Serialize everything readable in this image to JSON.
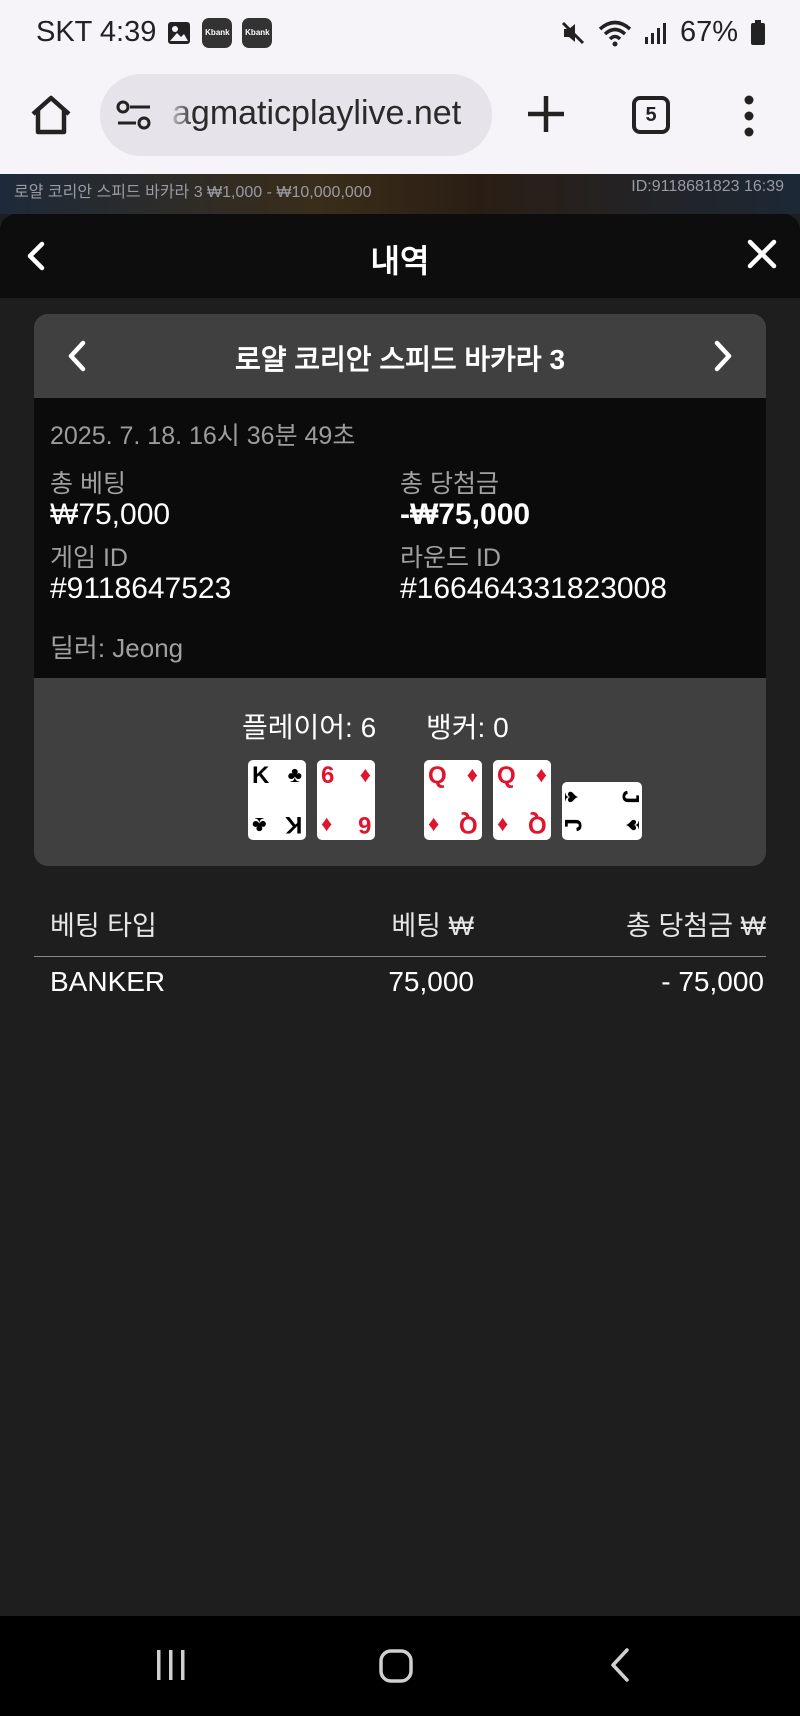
{
  "status_bar": {
    "carrier_time": "SKT 4:39",
    "notif_icons": [
      "image-icon",
      "kbank-icon",
      "kbank-icon"
    ],
    "kbank_label": "Kbank",
    "battery": "67%"
  },
  "browser": {
    "url": "agmaticplaylive.net",
    "tab_count": "5"
  },
  "game_strip": {
    "left_text": "로얄 코리안 스피드 바카라 3  ₩1,000 - ₩10,000,000",
    "right_text": "ID:9118681823  16:39"
  },
  "modal": {
    "title": "내역",
    "game_name": "로얄 코리안 스피드 바카라 3",
    "date": "2025. 7. 18. 16시 36분 49초",
    "total_bet_label": "총 베팅",
    "total_bet_value": "₩75,000",
    "total_win_label": "총 당첨금",
    "total_win_value": "-₩75,000",
    "game_id_label": "게임 ID",
    "game_id_value": "#9118647523",
    "round_id_label": "라운드 ID",
    "round_id_value": "#166464331823008",
    "dealer": "딜러: Jeong",
    "player_label": "플레이어: 6",
    "banker_label": "뱅커: 0",
    "player_cards": [
      {
        "rank": "K",
        "suit": "♣",
        "color": "#000000"
      },
      {
        "rank": "6",
        "suit": "♦",
        "color": "#e0142c"
      }
    ],
    "banker_cards": [
      {
        "rank": "Q",
        "suit": "♦",
        "color": "#e0142c"
      },
      {
        "rank": "Q",
        "suit": "♦",
        "color": "#e0142c"
      },
      {
        "rank": "J",
        "suit": "♠",
        "color": "#000000"
      }
    ]
  },
  "bets_table": {
    "headers": [
      "베팅 타입",
      "베팅 ₩",
      "총 당첨금 ₩"
    ],
    "rows": [
      {
        "type": "BANKER",
        "bet": "75,000",
        "win": "- 75,000"
      }
    ]
  },
  "colors": {
    "modal_bg": "#1e1e1e",
    "header_bg": "#0d0d0d",
    "card_nav_bg": "#404040",
    "red_suit": "#e0142c"
  }
}
